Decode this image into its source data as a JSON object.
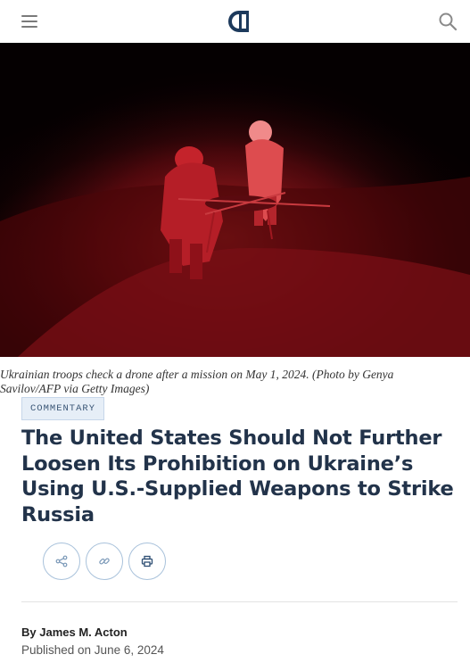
{
  "header": {
    "menu_icon": "hamburger-icon",
    "logo_icon": "carnegie-c-logo",
    "search_icon": "search-icon"
  },
  "hero": {
    "caption": "Ukrainian troops check a drone after a mission on May 1, 2024. (Photo by Genya Savilov/AFP via Getty Images)"
  },
  "article": {
    "category": "COMMENTARY",
    "title": "The United States Should Not Further Loosen Its Prohibition on Ukraine’s Using U.S.-Supplied Weapons to Strike Russia",
    "share_buttons": [
      "share-icon",
      "link-icon",
      "print-icon"
    ],
    "byline_prefix": "By ",
    "author": "James M. Acton",
    "published": "Published on June 6, 2024"
  },
  "colors": {
    "brand_navy": "#1d3a5c",
    "title": "#22334a",
    "badge_bg": "#e6eef7",
    "button_border": "#a9c2db"
  }
}
